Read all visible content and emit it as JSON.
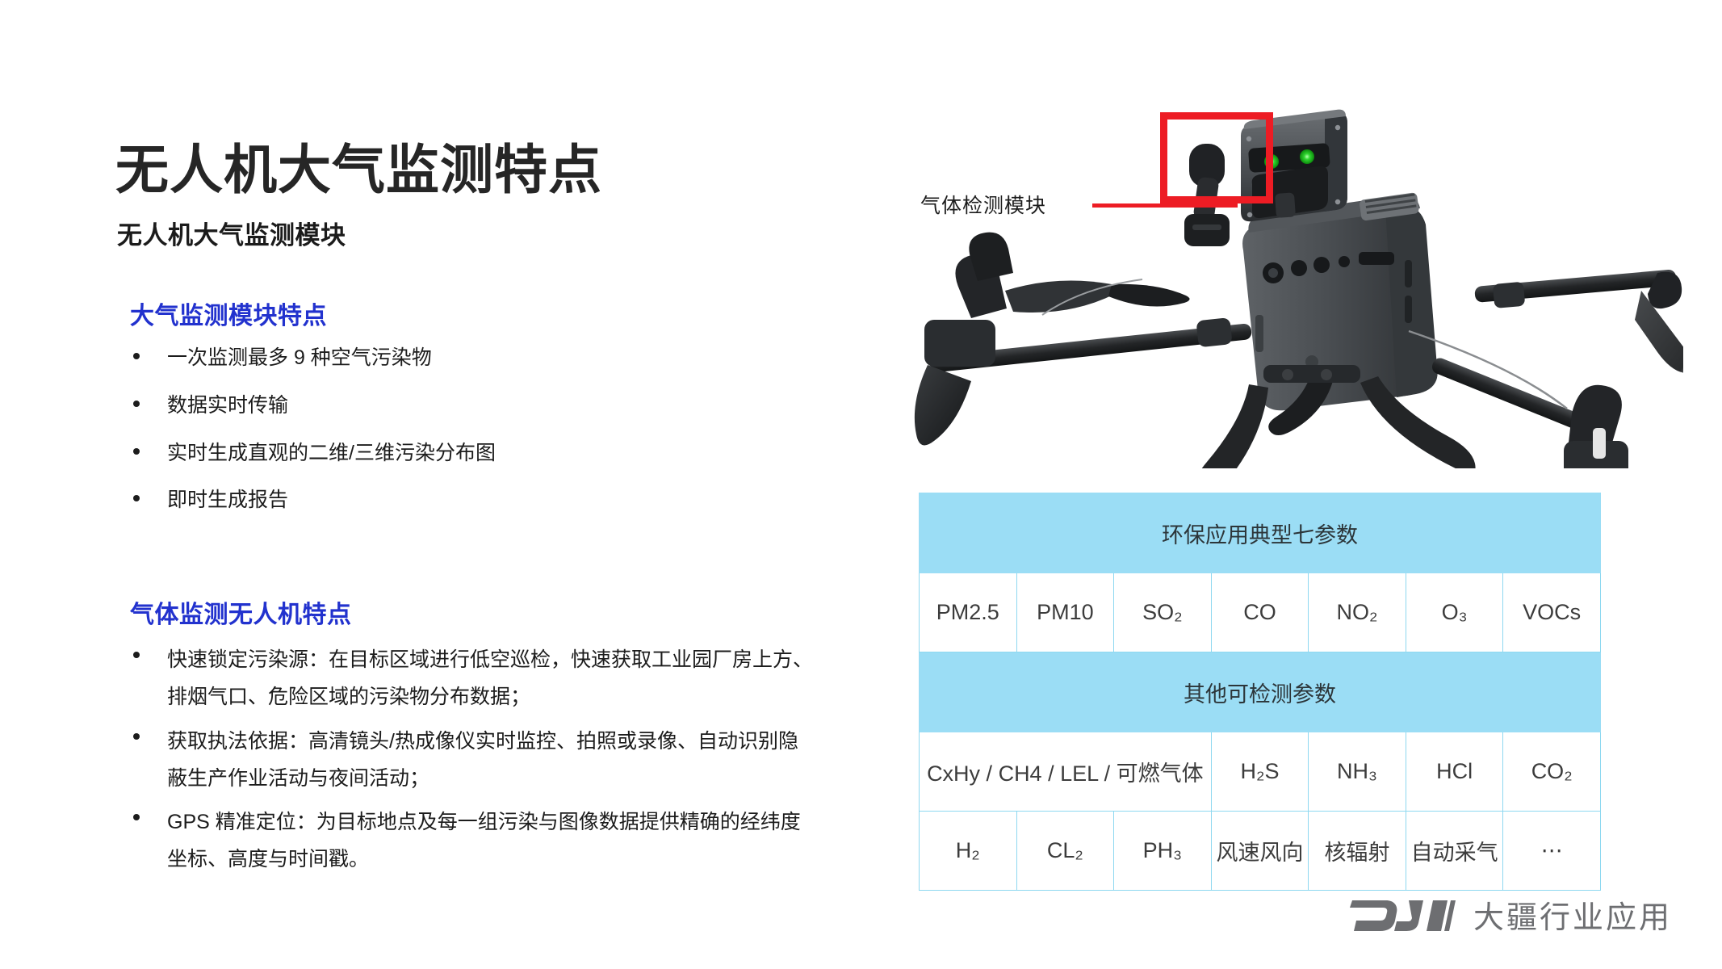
{
  "slide": {
    "title": "无人机大气监测特点",
    "subtitle": "无人机大气监测模块"
  },
  "sections": [
    {
      "heading": "大气监测模块特点",
      "bullets": [
        "一次监测最多 9 种空气污染物",
        "数据实时传输",
        "实时生成直观的二维/三维污染分布图",
        "即时生成报告"
      ]
    },
    {
      "heading": "气体监测无人机特点",
      "bullets": [
        "快速锁定污染源：在目标区域进行低空巡检，快速获取工业园厂房上方、排烟气口、危险区域的污染物分布数据；",
        "获取执法依据：高清镜头/热成像仪实时监控、拍照或录像、自动识别隐蔽生产作业活动与夜间活动；",
        "GPS 精准定位：为目标地点及每一组污染与图像数据提供精确的经纬度坐标、高度与时间戳。"
      ]
    }
  ],
  "photo": {
    "callout_label": "气体检测模块",
    "highlight_color": "#ED1C24",
    "led_color": "#22CC22",
    "subject": "drone-matrice-with-gas-module"
  },
  "table": {
    "group1_title": "环保应用典型七参数",
    "group1_items": [
      "PM2.5",
      "PM10",
      "SO₂",
      "CO",
      "NO₂",
      "O₃",
      "VOCs"
    ],
    "group2_title": "其他可检测参数",
    "group2_row1": [
      "CxHy / CH4 / LEL / 可燃气体",
      "H₂S",
      "NH₃",
      "HCl",
      "CO₂"
    ],
    "group2_row2": [
      "H₂",
      "CL₂",
      "PH₃",
      "风速风向",
      "核辐射",
      "自动采气",
      "⋯"
    ],
    "band_color": "#9BDDF5",
    "border_color": "#8ED8F0"
  },
  "branding": {
    "logo_text": "大疆行业应用",
    "logo_mark": "dji-logo-icon",
    "logo_color": "#6D6E71"
  }
}
